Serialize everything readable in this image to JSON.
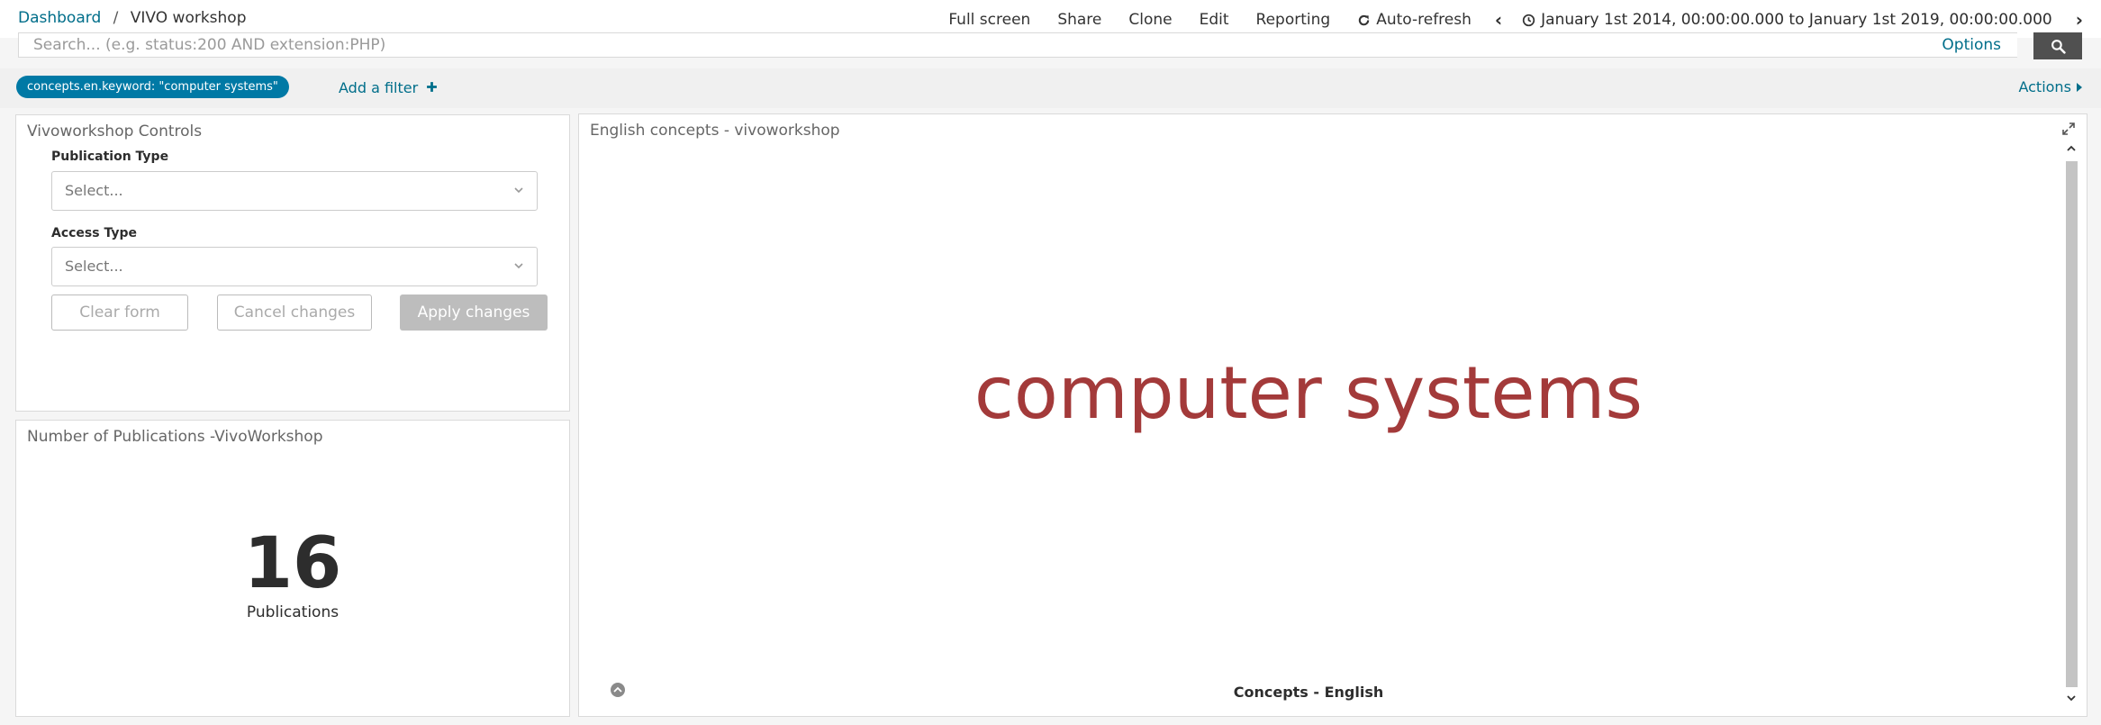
{
  "breadcrumb": {
    "root": "Dashboard",
    "separator": "/",
    "current": "VIVO workshop"
  },
  "topnav": {
    "full_screen": "Full screen",
    "share": "Share",
    "clone": "Clone",
    "edit": "Edit",
    "reporting": "Reporting",
    "auto_refresh": "Auto-refresh",
    "time_range": "January 1st 2014, 00:00:00.000 to January 1st 2019, 00:00:00.000"
  },
  "search": {
    "placeholder": "Search... (e.g. status:200 AND extension:PHP)",
    "value": "",
    "options": "Options"
  },
  "filterbar": {
    "filter_pill": "concepts.en.keyword: \"computer systems\"",
    "add_filter": "Add a filter",
    "actions": "Actions"
  },
  "controls_panel": {
    "title": "Vivoworkshop Controls",
    "publication_type_label": "Publication Type",
    "publication_type_value": "Select...",
    "access_type_label": "Access Type",
    "access_type_value": "Select...",
    "clear_form": "Clear form",
    "cancel_changes": "Cancel changes",
    "apply_changes": "Apply changes"
  },
  "metric_panel": {
    "title": "Number of Publications -VivoWorkshop",
    "value": "16",
    "label": "Publications"
  },
  "cloud_panel": {
    "title": "English concepts - vivoworkshop",
    "word": "computer systems",
    "axis_title": "Concepts - English"
  },
  "colors": {
    "accent": "#006e8a",
    "pill": "#0079a5",
    "cloud_word": "#a33a3a",
    "search_button": "#505050"
  },
  "icons": [
    "refresh-icon",
    "chevron-left-icon",
    "clock-icon",
    "chevron-right-icon",
    "search-icon",
    "plus-icon",
    "caret-right-icon",
    "chevron-down-icon",
    "expand-icon",
    "chevron-up-icon",
    "legend-toggle-icon"
  ]
}
